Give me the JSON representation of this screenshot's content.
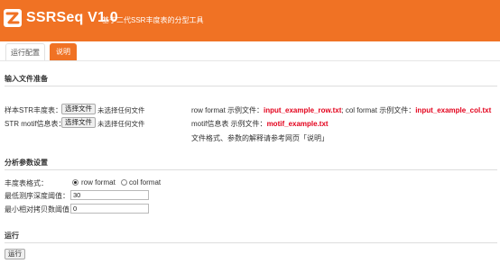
{
  "header": {
    "title": "SSRSeq V1.0",
    "subtitle": "基于二代SSR丰度表的分型工具",
    "bg_color": "#f07224"
  },
  "tabs": [
    {
      "label": "运行配置",
      "active": true
    },
    {
      "label": "说明",
      "active": false
    }
  ],
  "input_section": {
    "title": "输入文件准备",
    "str_table_label": "样本STR丰度表：",
    "motif_label": "STR motif信息表：",
    "choose_file": "选择文件",
    "no_file": "未选择任何文件",
    "row_prefix": "row format 示例文件：",
    "row_example": "input_example_row.txt",
    "col_prefix": "; col format 示例文件：",
    "col_example": "input_example_col.txt",
    "motif_prefix": "motif信息表 示例文件：",
    "motif_example": "motif_example.txt",
    "note": "文件格式、参数的解释请参考网页「说明」"
  },
  "params_section": {
    "title": "分析参数设置",
    "format_label": "丰度表格式：",
    "format_options": [
      "row format",
      "col format"
    ],
    "selected_format": "row format",
    "min_depth_label": "最低测序深度阈值：",
    "min_depth_value": "30",
    "min_copy_label": "最小相对拷贝数阈值：",
    "min_copy_value": "0"
  },
  "run_section": {
    "title": "运行",
    "button": "运行"
  }
}
